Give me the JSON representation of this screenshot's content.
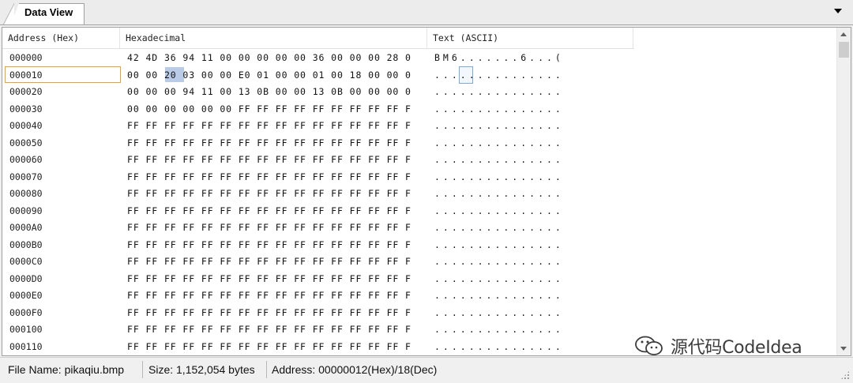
{
  "tab": {
    "title": "Data View"
  },
  "columns": {
    "address": "Address (Hex)",
    "hex": "Hexadecimal",
    "text": "Text (ASCII)"
  },
  "rows": [
    {
      "address": "000000",
      "hex": "42 4D 36 94 11 00 00 00 00 00 36 00 00 00 28 0",
      "ascii": "BM6.......6...("
    },
    {
      "address": "000010",
      "hex": "00 00 20 03 00 00 E0 01 00 00 01 00 18 00 00 0",
      "ascii": "...............",
      "selected": true
    },
    {
      "address": "000020",
      "hex": "00 00 00 94 11 00 13 0B 00 00 13 0B 00 00 00 0",
      "ascii": "..............."
    },
    {
      "address": "000030",
      "hex": "00 00 00 00 00 00 FF FF FF FF FF FF FF FF FF F",
      "ascii": "..............."
    },
    {
      "address": "000040",
      "hex": "FF FF FF FF FF FF FF FF FF FF FF FF FF FF FF F",
      "ascii": "..............."
    },
    {
      "address": "000050",
      "hex": "FF FF FF FF FF FF FF FF FF FF FF FF FF FF FF F",
      "ascii": "..............."
    },
    {
      "address": "000060",
      "hex": "FF FF FF FF FF FF FF FF FF FF FF FF FF FF FF F",
      "ascii": "..............."
    },
    {
      "address": "000070",
      "hex": "FF FF FF FF FF FF FF FF FF FF FF FF FF FF FF F",
      "ascii": "..............."
    },
    {
      "address": "000080",
      "hex": "FF FF FF FF FF FF FF FF FF FF FF FF FF FF FF F",
      "ascii": "..............."
    },
    {
      "address": "000090",
      "hex": "FF FF FF FF FF FF FF FF FF FF FF FF FF FF FF F",
      "ascii": "..............."
    },
    {
      "address": "0000A0",
      "hex": "FF FF FF FF FF FF FF FF FF FF FF FF FF FF FF F",
      "ascii": "..............."
    },
    {
      "address": "0000B0",
      "hex": "FF FF FF FF FF FF FF FF FF FF FF FF FF FF FF F",
      "ascii": "..............."
    },
    {
      "address": "0000C0",
      "hex": "FF FF FF FF FF FF FF FF FF FF FF FF FF FF FF F",
      "ascii": "..............."
    },
    {
      "address": "0000D0",
      "hex": "FF FF FF FF FF FF FF FF FF FF FF FF FF FF FF F",
      "ascii": "..............."
    },
    {
      "address": "0000E0",
      "hex": "FF FF FF FF FF FF FF FF FF FF FF FF FF FF FF F",
      "ascii": "..............."
    },
    {
      "address": "0000F0",
      "hex": "FF FF FF FF FF FF FF FF FF FF FF FF FF FF FF F",
      "ascii": "..............."
    },
    {
      "address": "000100",
      "hex": "FF FF FF FF FF FF FF FF FF FF FF FF FF FF FF F",
      "ascii": "..............."
    },
    {
      "address": "000110",
      "hex": "FF FF FF FF FF FF FF FF FF FF FF FF FF FF FF F",
      "ascii": "..............."
    }
  ],
  "highlight": {
    "byte": "20",
    "color": "#b9cbe6"
  },
  "status": {
    "file": "File Name: pikaqiu.bmp",
    "size": "Size: 1,152,054 bytes",
    "address": "Address: 00000012(Hex)/18(Dec)"
  },
  "watermark": {
    "text": "源代码CodeIdea",
    "icon": "wechat-icon"
  }
}
